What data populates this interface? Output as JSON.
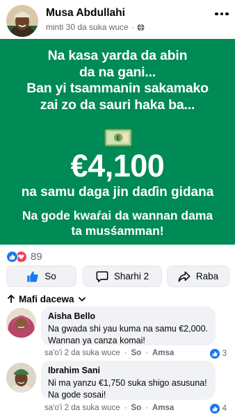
{
  "post": {
    "author": "Musa Abdullahi",
    "time": "minti 30 da suka wuce",
    "banner": {
      "headline_lines": [
        "Na kasa yarda da abin",
        "da na gani...",
        "Ban yi tsammanin sakamako",
        "zai zo da sauri haka ba..."
      ],
      "amount": "€4,100",
      "subtitle": "na samu daga jin daɗin gidana",
      "thanks_lines": [
        "Na gode kwaŕai da wannan dama",
        "ta musśamman!"
      ]
    },
    "reaction_count": "89"
  },
  "actions": {
    "like_label": "So",
    "comment_label": "Sharhi 2",
    "share_label": "Raba"
  },
  "sort_label": "Mafi dacewa",
  "comments": [
    {
      "author": "Aisha Bello",
      "text_lines": [
        "Na gwada shi yau kuma na samu €2,000.",
        "Wannan ya canza komai!"
      ],
      "time": "sa'o'i 2 da suka wuce",
      "like_action": "So",
      "reply_action": "Amsa",
      "likes": "3"
    },
    {
      "author": "Ibrahim Sani",
      "text_lines": [
        "Ni ma yanzu €1,750 suka shigo asusuna!",
        "Na gode sosai!"
      ],
      "time": "sa'o'i 2 da suka wuce",
      "like_action": "So",
      "reply_action": "Amsa",
      "likes": "4"
    }
  ],
  "colors": {
    "banner_green": "#008a55",
    "facebook_blue": "#1877f2",
    "love_red": "#f33e58",
    "secondary_text": "#65676b"
  },
  "icons": [
    "globe-icon",
    "more-icon",
    "banknote-icon",
    "like-icon",
    "love-icon",
    "comment-icon",
    "share-icon",
    "arrow-up-icon",
    "chevron-down-icon"
  ]
}
